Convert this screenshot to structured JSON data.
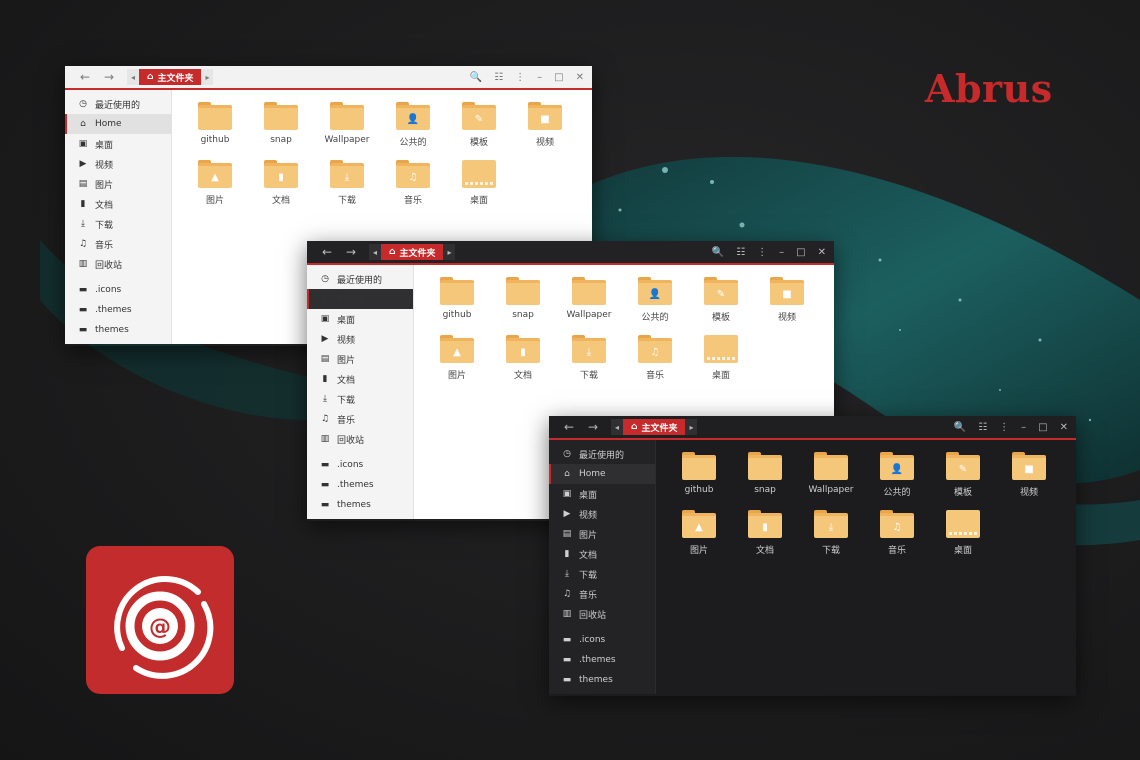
{
  "brand": {
    "name": "Abrus"
  },
  "colors": {
    "accent": "#c62a2a",
    "folder": "#f5c77a",
    "folder_tab": "#e8a54a"
  },
  "window": {
    "breadcrumb": "主文件夹",
    "nav": {
      "back": "←",
      "forward": "→"
    },
    "tools": {
      "search": "🔍",
      "view": "☷",
      "menu": "⋮",
      "minimize": "–",
      "maximize": "□",
      "close": "✕"
    }
  },
  "sidebar": {
    "items": [
      {
        "label": "最近使用的",
        "icon": "clock-icon",
        "glyph": "◷"
      },
      {
        "label": "Home",
        "icon": "home-icon",
        "glyph": "⌂",
        "active": true
      },
      {
        "label": "桌面",
        "icon": "desktop-icon",
        "glyph": "▣"
      },
      {
        "label": "视频",
        "icon": "video-icon",
        "glyph": "▶"
      },
      {
        "label": "图片",
        "icon": "image-icon",
        "glyph": "▤"
      },
      {
        "label": "文档",
        "icon": "document-icon",
        "glyph": "▮"
      },
      {
        "label": "下载",
        "icon": "download-icon",
        "glyph": "⤓"
      },
      {
        "label": "音乐",
        "icon": "music-icon",
        "glyph": "♫"
      },
      {
        "label": "回收站",
        "icon": "trash-icon",
        "glyph": "▥"
      }
    ],
    "bookmarks": [
      {
        "label": ".icons",
        "icon": "folder-icon",
        "glyph": "▬"
      },
      {
        "label": ".themes",
        "icon": "folder-icon",
        "glyph": "▬"
      },
      {
        "label": "themes",
        "icon": "folder-icon",
        "glyph": "▬"
      }
    ]
  },
  "folders": [
    {
      "label": "github",
      "icon": "folder-icon",
      "emblem": ""
    },
    {
      "label": "snap",
      "icon": "folder-icon",
      "emblem": ""
    },
    {
      "label": "Wallpaper",
      "icon": "folder-icon",
      "emblem": ""
    },
    {
      "label": "公共的",
      "icon": "folder-public-icon",
      "emblem": "👤"
    },
    {
      "label": "模板",
      "icon": "folder-templates-icon",
      "emblem": "✎"
    },
    {
      "label": "视频",
      "icon": "folder-videos-icon",
      "emblem": "■"
    },
    {
      "label": "图片",
      "icon": "folder-pictures-icon",
      "emblem": "▲"
    },
    {
      "label": "文档",
      "icon": "folder-documents-icon",
      "emblem": "▮"
    },
    {
      "label": "下载",
      "icon": "folder-download-icon",
      "emblem": "⤓"
    },
    {
      "label": "音乐",
      "icon": "folder-music-icon",
      "emblem": "♫"
    },
    {
      "label": "桌面",
      "icon": "folder-desktop-icon",
      "emblem": "",
      "flat": true
    }
  ]
}
